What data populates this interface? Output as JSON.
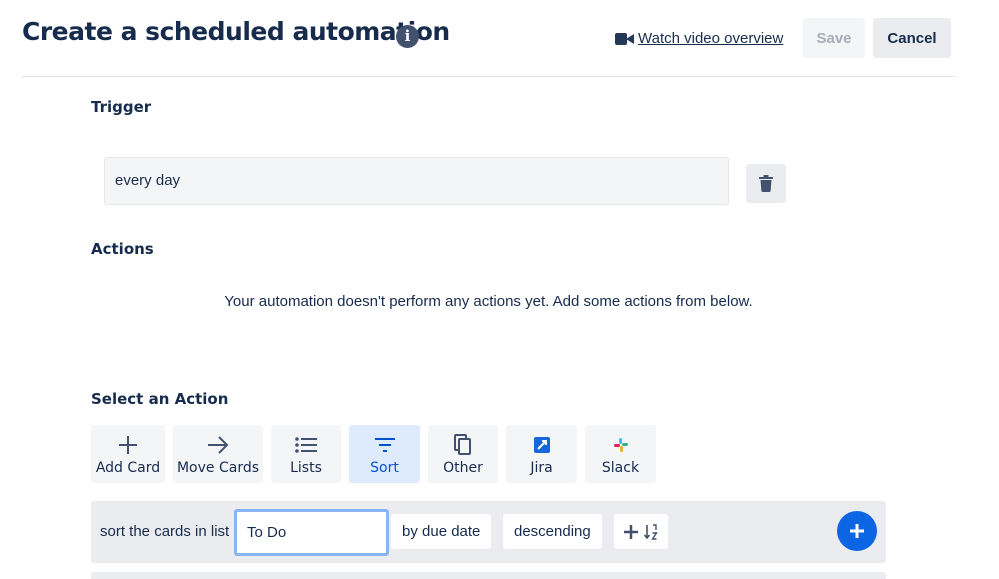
{
  "header": {
    "title": "Create a scheduled automation",
    "info_icon": "info-icon",
    "watch_link": "Watch video overview",
    "watch_icon": "video-camera-icon",
    "save_label": "Save",
    "cancel_label": "Cancel"
  },
  "trigger": {
    "heading": "Trigger",
    "value": "every day",
    "delete_icon": "trash-icon"
  },
  "actions": {
    "heading": "Actions",
    "empty_message": "Your automation doesn't perform any actions yet. Add some actions from below."
  },
  "select_action": {
    "heading": "Select an Action",
    "tiles": [
      {
        "label": "Add Card",
        "icon": "plus-icon"
      },
      {
        "label": "Move Cards",
        "icon": "arrow-right-icon"
      },
      {
        "label": "Lists",
        "icon": "list-icon"
      },
      {
        "label": "Sort",
        "icon": "filter-icon",
        "active": true
      },
      {
        "label": "Other",
        "icon": "copy-icon"
      },
      {
        "label": "Jira",
        "icon": "jira-icon"
      },
      {
        "label": "Slack",
        "icon": "slack-icon"
      }
    ]
  },
  "sort_action": {
    "prefix": "sort the cards in list",
    "list_value": "To Do",
    "by_label": "by due date",
    "order_label": "descending",
    "add_sort_icon": "plus-sort-icon",
    "add_button_icon": "plus-circle-icon"
  },
  "colors": {
    "accent": "#0c66e4",
    "active_tile_bg": "#deebff",
    "active_tile_text": "#0052cc",
    "focus_border": "#8bb4f5",
    "text": "#172b4d"
  }
}
